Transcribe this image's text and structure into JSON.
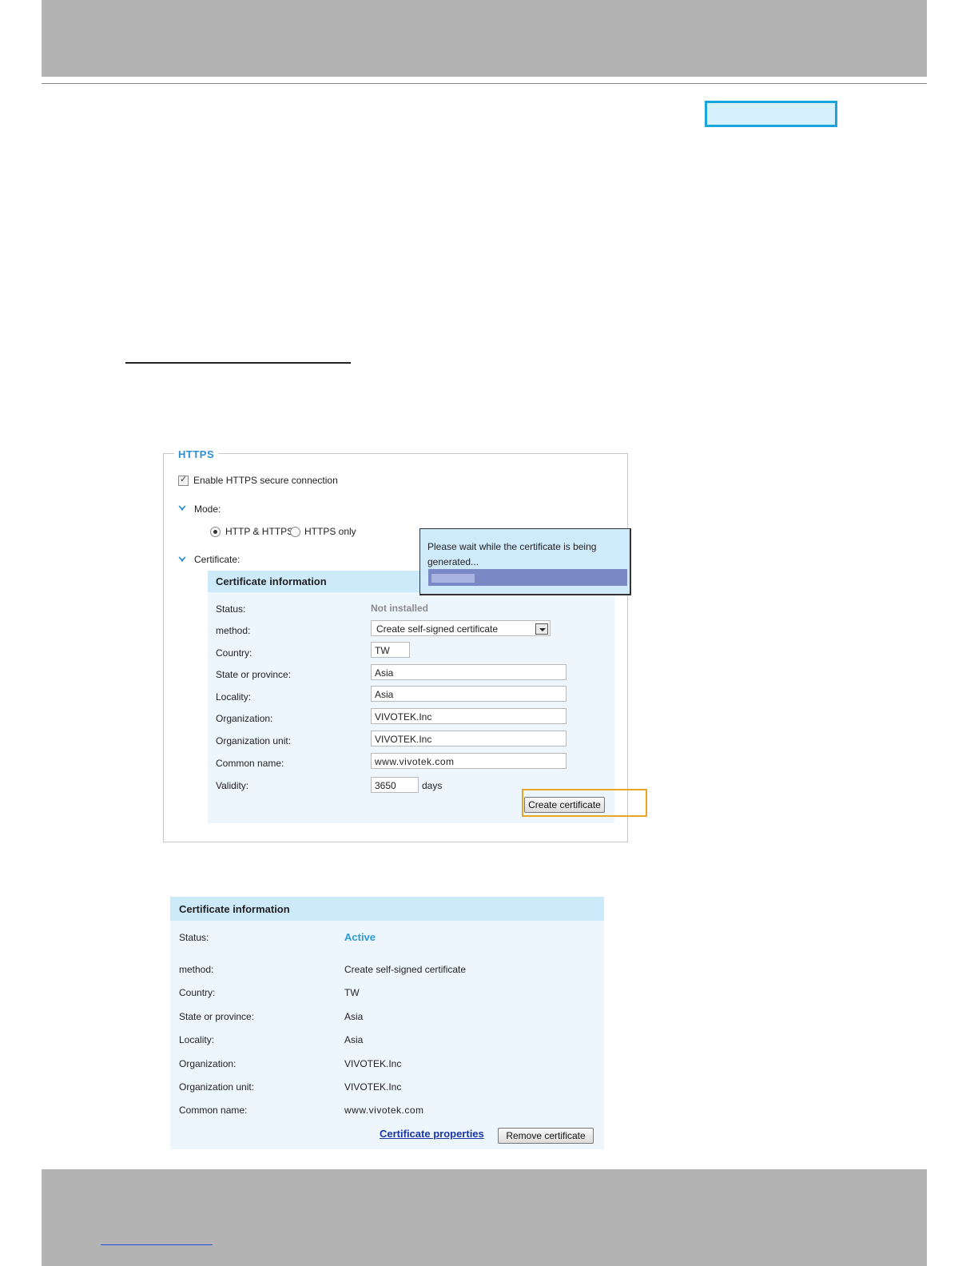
{
  "https_panel": {
    "legend": "HTTPS",
    "enable_label": "Enable HTTPS secure connection",
    "enable_checked": true,
    "mode_label": "Mode:",
    "mode_options": [
      "HTTP & HTTPS",
      "HTTPS only"
    ],
    "mode_selected": "HTTP & HTTPS",
    "certificate_label": "Certificate:",
    "cert_info_title": "Certificate information",
    "fields": {
      "status_label": "Status:",
      "status_value": "Not installed",
      "method_label": "method:",
      "method_value": "Create self-signed certificate",
      "country_label": "Country:",
      "country_value": "TW",
      "state_label": "State or province:",
      "state_value": "Asia",
      "locality_label": "Locality:",
      "locality_value": "Asia",
      "org_label": "Organization:",
      "org_value": "VIVOTEK.Inc",
      "org_unit_label": "Organization unit:",
      "org_unit_value": "VIVOTEK.Inc",
      "common_name_label": "Common name:",
      "common_name_value": "www.vivotek.com",
      "validity_label": "Validity:",
      "validity_value": "3650",
      "validity_unit": "days"
    },
    "create_button": "Create certificate",
    "wait_message": "Please wait while the certificate is being generated...",
    "progress_fraction": 0.22
  },
  "active_cert": {
    "title": "Certificate information",
    "status_label": "Status:",
    "status_value": "Active",
    "status_color": "#2f9bd6",
    "method_label": "method:",
    "method_value": "Create self-signed certificate",
    "country_label": "Country:",
    "country_value": "TW",
    "state_label": "State or province:",
    "state_value": "Asia",
    "locality_label": "Locality:",
    "locality_value": "Asia",
    "org_label": "Organization:",
    "org_value": "VIVOTEK.Inc",
    "org_unit_label": "Organization unit:",
    "org_unit_value": "VIVOTEK.Inc",
    "common_name_label": "Common name:",
    "common_name_value": "www.vivotek.com",
    "properties_link": "Certificate properties",
    "remove_button": "Remove certificate"
  }
}
